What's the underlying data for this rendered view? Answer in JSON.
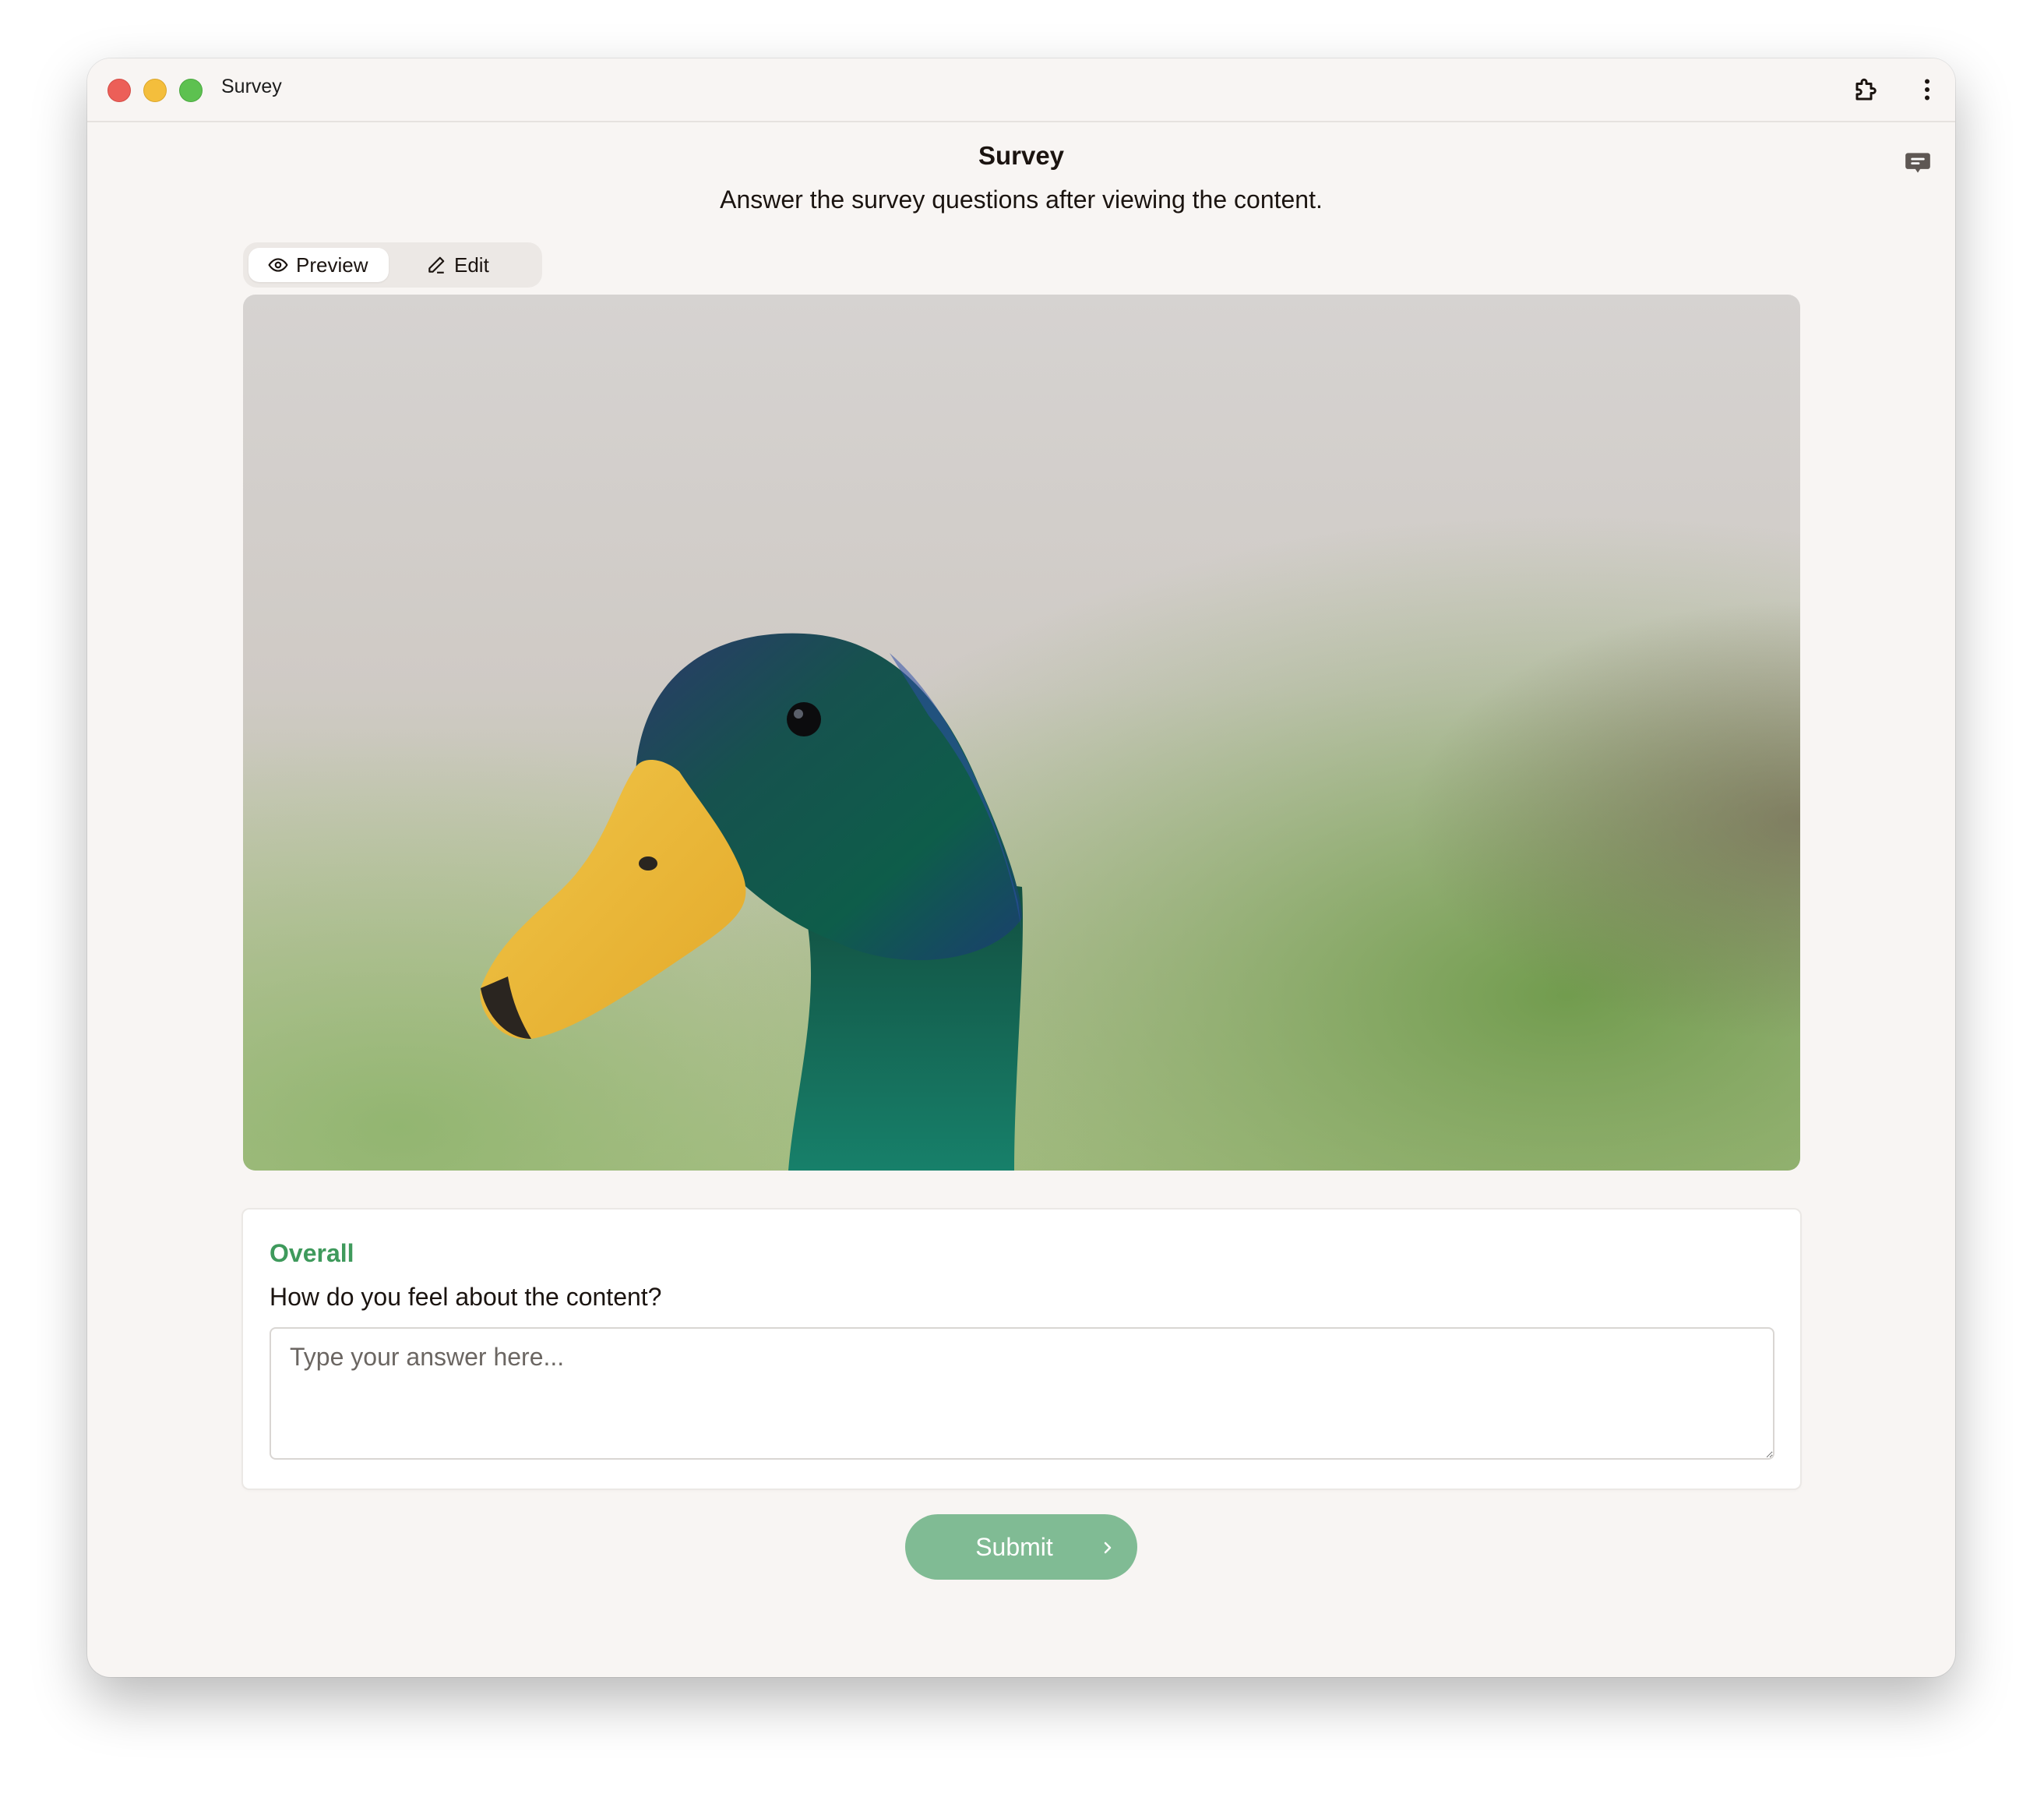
{
  "window": {
    "title": "Survey"
  },
  "header": {
    "title": "Survey",
    "subtitle": "Answer the survey questions after viewing the content."
  },
  "mode_toggle": {
    "preview_label": "Preview",
    "edit_label": "Edit",
    "selected": "Preview"
  },
  "content": {
    "image": "mallard-duck-head"
  },
  "question": {
    "section": "Overall",
    "prompt": "How do you feel about the content?",
    "placeholder": "Type your answer here...",
    "value": ""
  },
  "submit": {
    "label": "Submit"
  },
  "icons": {
    "extension": "puzzle-piece-icon",
    "more": "more-vertical-icon",
    "feedback": "chat-bubble-icon",
    "preview": "eye-icon",
    "edit": "pencil-icon",
    "submit": "chevron-right-icon"
  },
  "colors": {
    "accent": "#3f9a5c",
    "submit_bg": "#80bb94",
    "window_bg": "#f8f5f3"
  }
}
